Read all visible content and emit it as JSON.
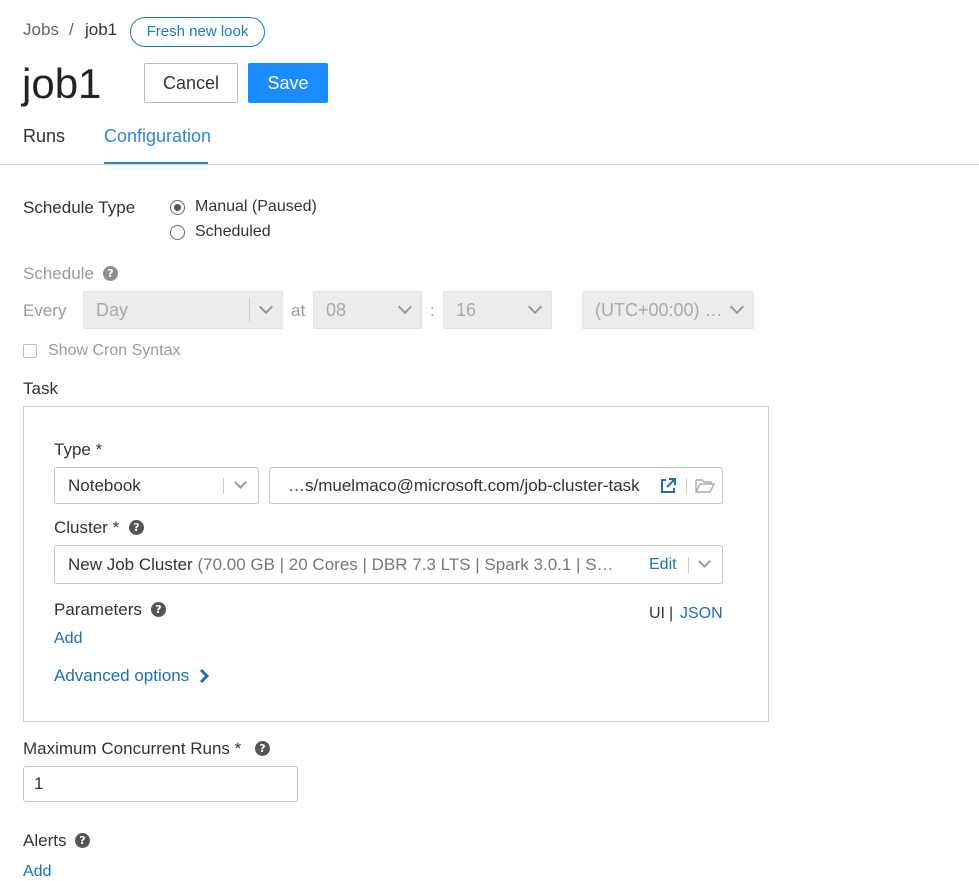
{
  "breadcrumb": {
    "root": "Jobs",
    "separator": "/",
    "current": "job1"
  },
  "fresh_look_label": "Fresh new look",
  "page_title": "job1",
  "actions": {
    "cancel": "Cancel",
    "save": "Save"
  },
  "tabs": [
    {
      "label": "Runs",
      "active": false
    },
    {
      "label": "Configuration",
      "active": true
    }
  ],
  "schedule_type": {
    "label": "Schedule Type",
    "options": [
      {
        "label": "Manual (Paused)",
        "selected": true
      },
      {
        "label": "Scheduled",
        "selected": false
      }
    ]
  },
  "schedule": {
    "label": "Schedule",
    "every_label": "Every",
    "period": "Day",
    "at_label": "at",
    "hour": "08",
    "colon": ":",
    "minute": "16",
    "timezone": "(UTC+00:00) …",
    "cron_label": "Show Cron Syntax"
  },
  "task": {
    "label": "Task",
    "type_label": "Type *",
    "type_value": "Notebook",
    "notebook_path": "…s/muelmaco@microsoft.com/job-cluster-task",
    "cluster_label": "Cluster *",
    "cluster_name": "New Job Cluster",
    "cluster_details": "(70.00 GB | 20 Cores | DBR 7.3 LTS | Spark 3.0.1 | S…",
    "cluster_edit": "Edit",
    "parameters_label": "Parameters",
    "parameters_ui": "UI",
    "parameters_sep": "|",
    "parameters_json": "JSON",
    "parameters_add": "Add",
    "advanced_options": "Advanced options"
  },
  "max_concurrent_runs": {
    "label": "Maximum Concurrent Runs *",
    "value": "1"
  },
  "alerts": {
    "label": "Alerts",
    "add": "Add"
  },
  "colors": {
    "accent": "#1a8cff",
    "link": "#1b6fb8",
    "tab_active": "#2f86d3"
  },
  "icons": [
    "help-icon",
    "external-link-icon",
    "folder-open-icon",
    "chevron-down-icon",
    "chevron-right-icon"
  ]
}
